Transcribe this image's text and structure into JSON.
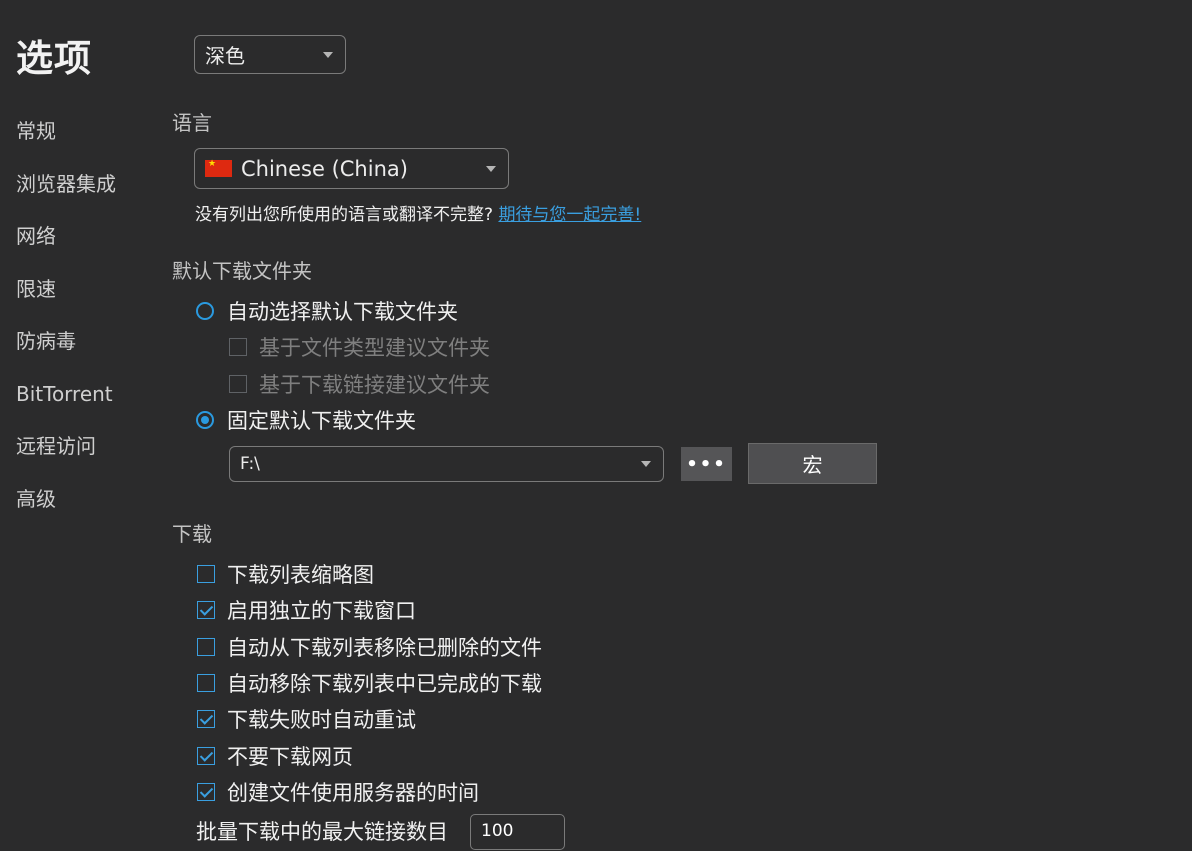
{
  "window": {
    "title": "选项"
  },
  "sidebar": {
    "items": [
      {
        "label": "常规"
      },
      {
        "label": "浏览器集成"
      },
      {
        "label": "网络"
      },
      {
        "label": "限速"
      },
      {
        "label": "防病毒"
      },
      {
        "label": "BitTorrent"
      },
      {
        "label": "远程访问"
      },
      {
        "label": "高级"
      }
    ]
  },
  "theme": {
    "selected": "深色"
  },
  "language": {
    "section_title": "语言",
    "selected": "Chinese (China)",
    "flag_icon": "china-flag-icon",
    "note": "没有列出您所使用的语言或翻译不完整?",
    "link": "期待与您一起完善!"
  },
  "default_folder": {
    "section_title": "默认下载文件夹",
    "auto_select": {
      "label": "自动选择默认下载文件夹",
      "checked": false
    },
    "suggest_by_type": {
      "label": "基于文件类型建议文件夹",
      "checked": false,
      "disabled": true
    },
    "suggest_by_link": {
      "label": "基于下载链接建议文件夹",
      "checked": false,
      "disabled": true
    },
    "fixed": {
      "label": "固定默认下载文件夹",
      "checked": true
    },
    "path": "F:\\",
    "browse_label": "•••",
    "macro_label": "宏"
  },
  "downloads": {
    "section_title": "下载",
    "options": [
      {
        "label": "下载列表缩略图",
        "checked": false
      },
      {
        "label": "启用独立的下载窗口",
        "checked": true
      },
      {
        "label": "自动从下载列表移除已删除的文件",
        "checked": false
      },
      {
        "label": "自动移除下载列表中已完成的下载",
        "checked": false
      },
      {
        "label": "下载失败时自动重试",
        "checked": true
      },
      {
        "label": "不要下载网页",
        "checked": true
      },
      {
        "label": "创建文件使用服务器的时间",
        "checked": true
      }
    ],
    "batch_label": "批量下载中的最大链接数目",
    "batch_value": "100"
  },
  "colors": {
    "background": "#2b2b2c",
    "accent": "#2a9ae0",
    "link": "#3a9fe0"
  }
}
